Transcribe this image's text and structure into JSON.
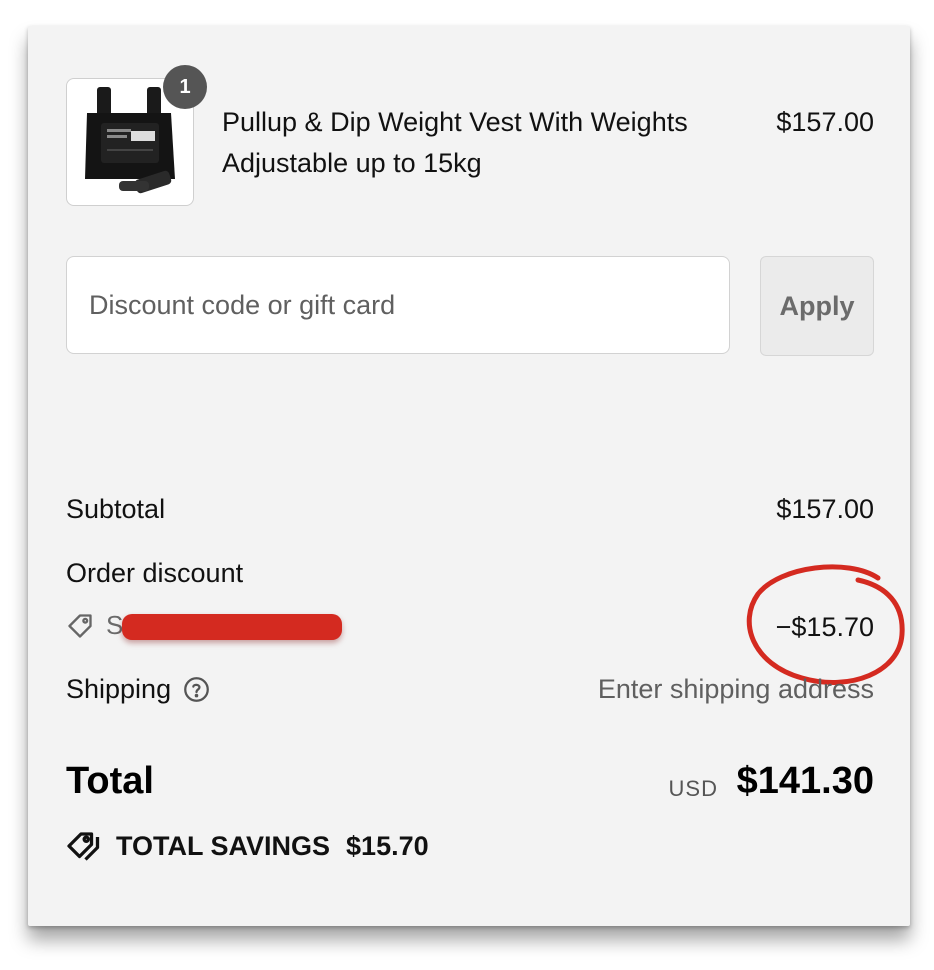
{
  "line_item": {
    "quantity": "1",
    "name": "Pullup & Dip Weight Vest With Weights Adjustable up to 15kg",
    "price": "$157.00",
    "image_icon": "weight-vest-product-image"
  },
  "discount": {
    "placeholder": "Discount code or gift card",
    "value": "",
    "apply_label": "Apply"
  },
  "summary": {
    "subtotal_label": "Subtotal",
    "subtotal_value": "$157.00",
    "order_discount_label": "Order discount",
    "discount_code_visible": "S",
    "discount_value": "−$15.70",
    "shipping_label": "Shipping",
    "shipping_value": "Enter shipping address",
    "total_label": "Total",
    "currency": "USD",
    "total_value": "$141.30",
    "savings_label": "TOTAL SAVINGS",
    "savings_value": "$15.70"
  },
  "colors": {
    "panel_background": "#f3f3f3",
    "badge": "#555555",
    "annotation_red": "#d42a20"
  }
}
